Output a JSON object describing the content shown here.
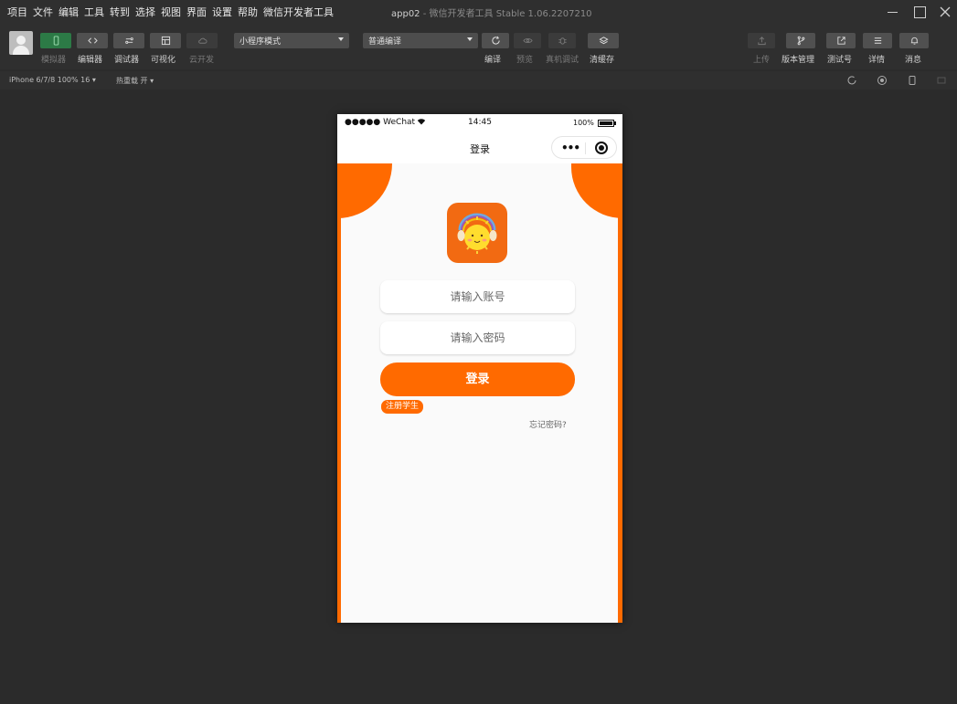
{
  "menu": [
    "项目",
    "文件",
    "编辑",
    "工具",
    "转到",
    "选择",
    "视图",
    "界面",
    "设置",
    "帮助",
    "微信开发者工具"
  ],
  "window_title": {
    "project": "app02",
    "app": " - 微信开发者工具 Stable 1.06.2207210"
  },
  "toolbar": {
    "left_buttons": [
      {
        "label": "模拟器",
        "icon": "phone-icon",
        "active": true
      },
      {
        "label": "编辑器",
        "icon": "code-icon"
      },
      {
        "label": "调试器",
        "icon": "debug-icon"
      },
      {
        "label": "可视化",
        "icon": "layout-icon"
      },
      {
        "label": "云开发",
        "icon": "cloud-icon",
        "disabled": true
      }
    ],
    "mode_select": "小程序模式",
    "compile_select": "普通编译",
    "mid_buttons": [
      {
        "label": "编译",
        "icon": "refresh-icon"
      },
      {
        "label": "预览",
        "icon": "eye-icon",
        "disabled": true
      },
      {
        "label": "真机调试",
        "icon": "bug-icon",
        "disabled": true
      },
      {
        "label": "清缓存",
        "icon": "layers-icon"
      }
    ],
    "right_buttons": [
      {
        "label": "上传",
        "icon": "upload-icon",
        "disabled": true
      },
      {
        "label": "版本管理",
        "icon": "branch-icon"
      },
      {
        "label": "测试号",
        "icon": "external-icon"
      },
      {
        "label": "详情",
        "icon": "menu-icon"
      },
      {
        "label": "消息",
        "icon": "bell-icon"
      }
    ]
  },
  "subbar": {
    "device": "iPhone 6/7/8 100% 16 ▾",
    "hot_reload": "热重载 开 ▾"
  },
  "phone": {
    "carrier": "●●●●● WeChat",
    "time": "14:45",
    "battery": "100%",
    "battery_level": 1.0,
    "nav_title": "登录",
    "account_placeholder": "请输入账号",
    "password_placeholder": "请输入密码",
    "login_label": "登录",
    "register_label": "注册学生",
    "forgot_label": "忘记密码?"
  },
  "colors": {
    "accent": "#ff6a00",
    "active_green": "#2c7a46",
    "background": "#2b2b2b"
  }
}
